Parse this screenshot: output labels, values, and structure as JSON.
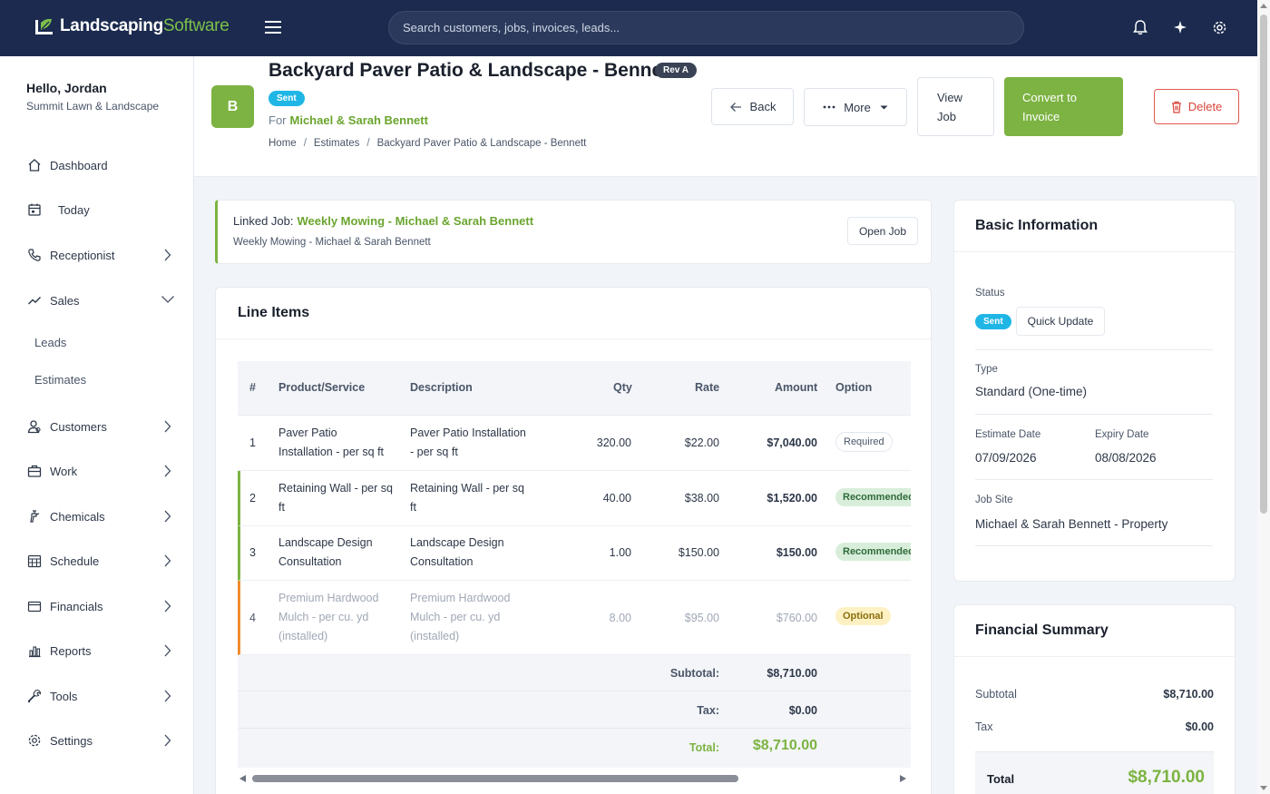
{
  "app": {
    "logo_main": "Landscaping",
    "logo_accent": "Software",
    "search_placeholder": "Search customers, jobs, invoices, leads..."
  },
  "user": {
    "greeting": "Hello, Jordan",
    "company": "Summit Lawn & Landscape"
  },
  "sidebar": {
    "items": [
      {
        "label": "Dashboard",
        "icon": "home-icon"
      },
      {
        "label": "Today",
        "icon": "calendar-icon"
      },
      {
        "label": "Receptionist",
        "icon": "phone-icon"
      },
      {
        "label": "Sales",
        "icon": "trend-icon"
      },
      {
        "label": "Customers",
        "icon": "customers-icon"
      },
      {
        "label": "Work",
        "icon": "briefcase-icon"
      },
      {
        "label": "Chemicals",
        "icon": "sprayer-icon"
      },
      {
        "label": "Schedule",
        "icon": "grid-calendar-icon"
      },
      {
        "label": "Financials",
        "icon": "wallet-icon"
      },
      {
        "label": "Reports",
        "icon": "bar-chart-icon"
      },
      {
        "label": "Tools",
        "icon": "wrench-icon"
      },
      {
        "label": "Settings",
        "icon": "gear-icon"
      }
    ],
    "sales_sub": [
      "Leads",
      "Estimates"
    ]
  },
  "header": {
    "avatar_letter": "B",
    "title": "Backyard Paver Patio & Landscape - Bennett",
    "revision": "Rev A",
    "status": "Sent",
    "for_label": "For",
    "customer": "Michael & Sarah Bennett",
    "breadcrumb": [
      "Home",
      "Estimates",
      "Backyard Paver Patio & Landscape - Bennett"
    ],
    "buttons": {
      "back": "Back",
      "more": "More",
      "view_job_1": "View",
      "view_job_2": "Job",
      "convert_1": "Convert to",
      "convert_2": "Invoice",
      "delete": "Delete"
    }
  },
  "linked_job": {
    "label": "Linked Job:",
    "name": "Weekly Mowing - Michael & Sarah Bennett",
    "sub": "Weekly Mowing - Michael & Sarah Bennett",
    "open_button": "Open Job"
  },
  "line_items": {
    "title": "Line Items",
    "columns": [
      "#",
      "Product/Service",
      "Description",
      "Qty",
      "Rate",
      "Amount",
      "Option"
    ],
    "rows": [
      {
        "num": "1",
        "product": [
          "Paver Patio",
          "Installation - per sq ft"
        ],
        "description": [
          "Paver Patio Installation",
          "- per sq ft"
        ],
        "qty": "320.00",
        "rate": "$22.00",
        "amount": "$7,040.00",
        "option": "Required"
      },
      {
        "num": "2",
        "product": [
          "Retaining Wall - per sq",
          "ft"
        ],
        "description": [
          "Retaining Wall - per sq",
          "ft"
        ],
        "qty": "40.00",
        "rate": "$38.00",
        "amount": "$1,520.00",
        "option": "Recommended"
      },
      {
        "num": "3",
        "product": [
          "Landscape Design",
          "Consultation"
        ],
        "description": [
          "Landscape Design",
          "Consultation"
        ],
        "qty": "1.00",
        "rate": "$150.00",
        "amount": "$150.00",
        "option": "Recommended"
      },
      {
        "num": "4",
        "product": [
          "Premium Hardwood",
          "Mulch - per cu. yd",
          "(installed)"
        ],
        "description": [
          "Premium Hardwood",
          "Mulch - per cu. yd",
          "(installed)"
        ],
        "qty": "8.00",
        "rate": "$95.00",
        "amount": "$760.00",
        "option": "Optional"
      }
    ],
    "subtotal_label": "Subtotal:",
    "subtotal": "$8,710.00",
    "tax_label": "Tax:",
    "tax": "$0.00",
    "total_label": "Total:",
    "total": "$8,710.00"
  },
  "basic_info": {
    "title": "Basic Information",
    "status_label": "Status",
    "status": "Sent",
    "quick_update": "Quick Update",
    "type_label": "Type",
    "type": "Standard (One-time)",
    "estimate_date_label": "Estimate Date",
    "estimate_date": "07/09/2026",
    "expiry_date_label": "Expiry Date",
    "expiry_date": "08/08/2026",
    "job_site_label": "Job Site",
    "job_site": "Michael & Sarah Bennett - Property"
  },
  "financial_summary": {
    "title": "Financial Summary",
    "subtotal_label": "Subtotal",
    "subtotal": "$8,710.00",
    "tax_label": "Tax",
    "tax": "$0.00",
    "total_label": "Total",
    "total": "$8,710.00"
  },
  "colors": {
    "topbar": "#1b2a4e",
    "brand_green": "#7cb342",
    "status_blue": "#1fb6e6",
    "delete_red": "#d9443a"
  }
}
